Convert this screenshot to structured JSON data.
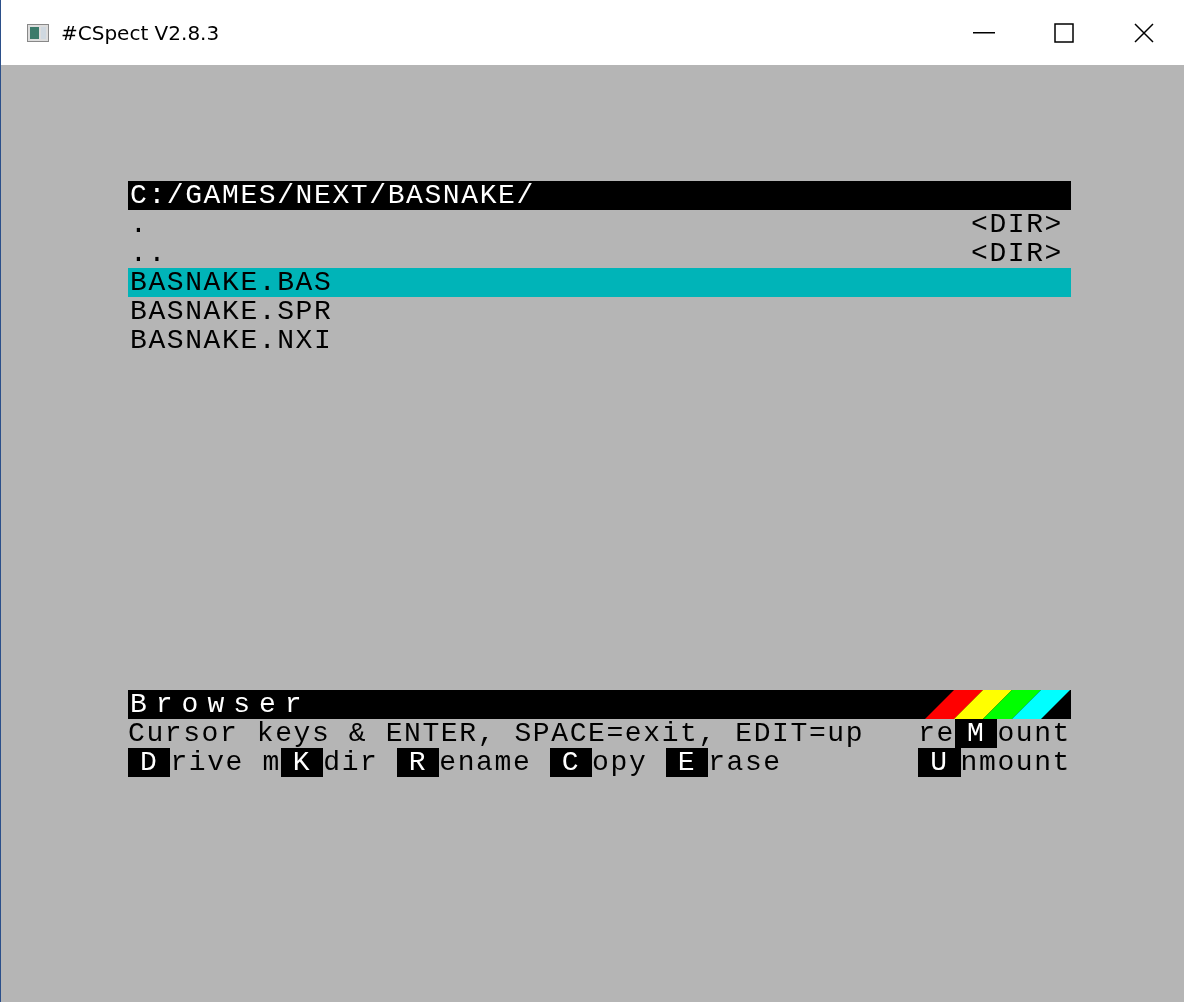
{
  "window": {
    "title": "#CSpect V2.8.3"
  },
  "browser": {
    "path": "C:/GAMES/NEXT/BASNAKE/",
    "files": [
      {
        "name": ".",
        "info": "<DIR>",
        "selected": false
      },
      {
        "name": "..",
        "info": "<DIR>",
        "selected": false
      },
      {
        "name": "BASNAKE.BAS",
        "selected": true
      },
      {
        "name": "BASNAKE.SPR",
        "selected": false
      },
      {
        "name": "BASNAKE.NXI",
        "selected": false
      }
    ],
    "footer_title": "Browser",
    "help_lines": [
      {
        "left": [
          {
            "kind": "text",
            "text": "Cursor keys & ENTER, SPACE=exit, EDIT=up"
          }
        ],
        "right": [
          {
            "kind": "text",
            "text": "re"
          },
          {
            "kind": "key",
            "text": "M"
          },
          {
            "kind": "text",
            "text": "ount"
          }
        ]
      },
      {
        "left": [
          {
            "kind": "key",
            "text": "D"
          },
          {
            "kind": "text",
            "text": "rive m"
          },
          {
            "kind": "key",
            "text": "K"
          },
          {
            "kind": "text",
            "text": "dir "
          },
          {
            "kind": "key",
            "text": "R"
          },
          {
            "kind": "text",
            "text": "ename "
          },
          {
            "kind": "key",
            "text": "C"
          },
          {
            "kind": "text",
            "text": "opy "
          },
          {
            "kind": "key",
            "text": "E"
          },
          {
            "kind": "text",
            "text": "rase"
          }
        ],
        "right": [
          {
            "kind": "key",
            "text": "U"
          },
          {
            "kind": "text",
            "text": "nmount"
          }
        ]
      }
    ]
  }
}
